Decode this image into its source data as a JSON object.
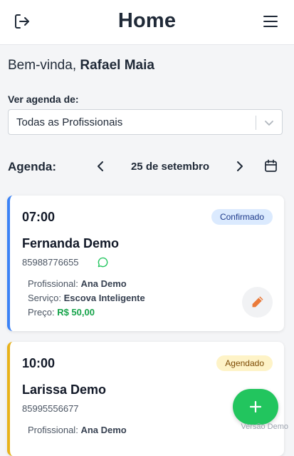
{
  "header": {
    "title": "Home",
    "logout_icon": "logout-icon",
    "menu_icon": "hamburger-menu-icon"
  },
  "welcome": {
    "greeting": "Bem-vinda,",
    "user_name": "Rafael Maia"
  },
  "filter": {
    "label": "Ver agenda de:",
    "selected": "Todas as Profissionais"
  },
  "agenda": {
    "label": "Agenda:",
    "date": "25 de setembro"
  },
  "appointments": [
    {
      "time": "07:00",
      "status": "Confirmado",
      "status_color": "#dbeafe",
      "accent_color": "#3b82f6",
      "client": "Fernanda Demo",
      "phone": "85988776655",
      "professional_label": "Profissional:",
      "professional": "Ana Demo",
      "service_label": "Serviço:",
      "service": "Escova Inteligente",
      "price_label": "Preço:",
      "price": "R$ 50,00"
    },
    {
      "time": "10:00",
      "status": "Agendado",
      "status_color": "#fef3c7",
      "accent_color": "#e8b21a",
      "client": "Larissa Demo",
      "phone": "85995556677",
      "professional_label": "Profissional:",
      "professional": "Ana Demo"
    }
  ],
  "colors": {
    "confirmed_accent": "#3b82f6",
    "scheduled_accent": "#e8b21a",
    "price_green": "#16a34a",
    "fab_green": "#22c55e",
    "edit_icon": "#ea7a3a"
  },
  "version": "Versão Demo"
}
